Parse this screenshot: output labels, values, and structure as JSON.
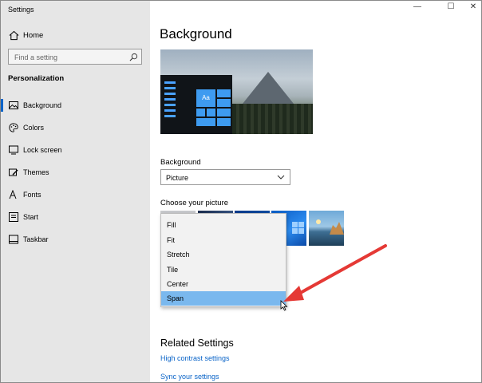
{
  "window": {
    "title": "Settings",
    "minimize": "—",
    "maximize": "☐",
    "close": "✕"
  },
  "sidebar": {
    "home_label": "Home",
    "search_placeholder": "Find a setting",
    "section_title": "Personalization",
    "items": [
      {
        "label": "Background",
        "icon": "picture-icon",
        "selected": true
      },
      {
        "label": "Colors",
        "icon": "palette-icon"
      },
      {
        "label": "Lock screen",
        "icon": "lock-screen-icon"
      },
      {
        "label": "Themes",
        "icon": "brush-icon"
      },
      {
        "label": "Fonts",
        "icon": "font-icon"
      },
      {
        "label": "Start",
        "icon": "start-icon"
      },
      {
        "label": "Taskbar",
        "icon": "taskbar-icon"
      }
    ]
  },
  "main": {
    "page_title": "Background",
    "preview_tile_label": "Aa",
    "background_label": "Background",
    "background_value": "Picture",
    "choose_picture_label": "Choose your picture",
    "fit_menu": {
      "options": [
        "Fill",
        "Fit",
        "Stretch",
        "Tile",
        "Center",
        "Span"
      ],
      "highlighted": "Span"
    },
    "related_title": "Related Settings",
    "links": [
      "High contrast settings",
      "Sync your settings"
    ]
  },
  "colors": {
    "accent": "#0a64c8",
    "sidebar_bg": "#e6e6e6",
    "menu_highlight": "#7ab8ee",
    "annotation_arrow": "#e53935"
  }
}
